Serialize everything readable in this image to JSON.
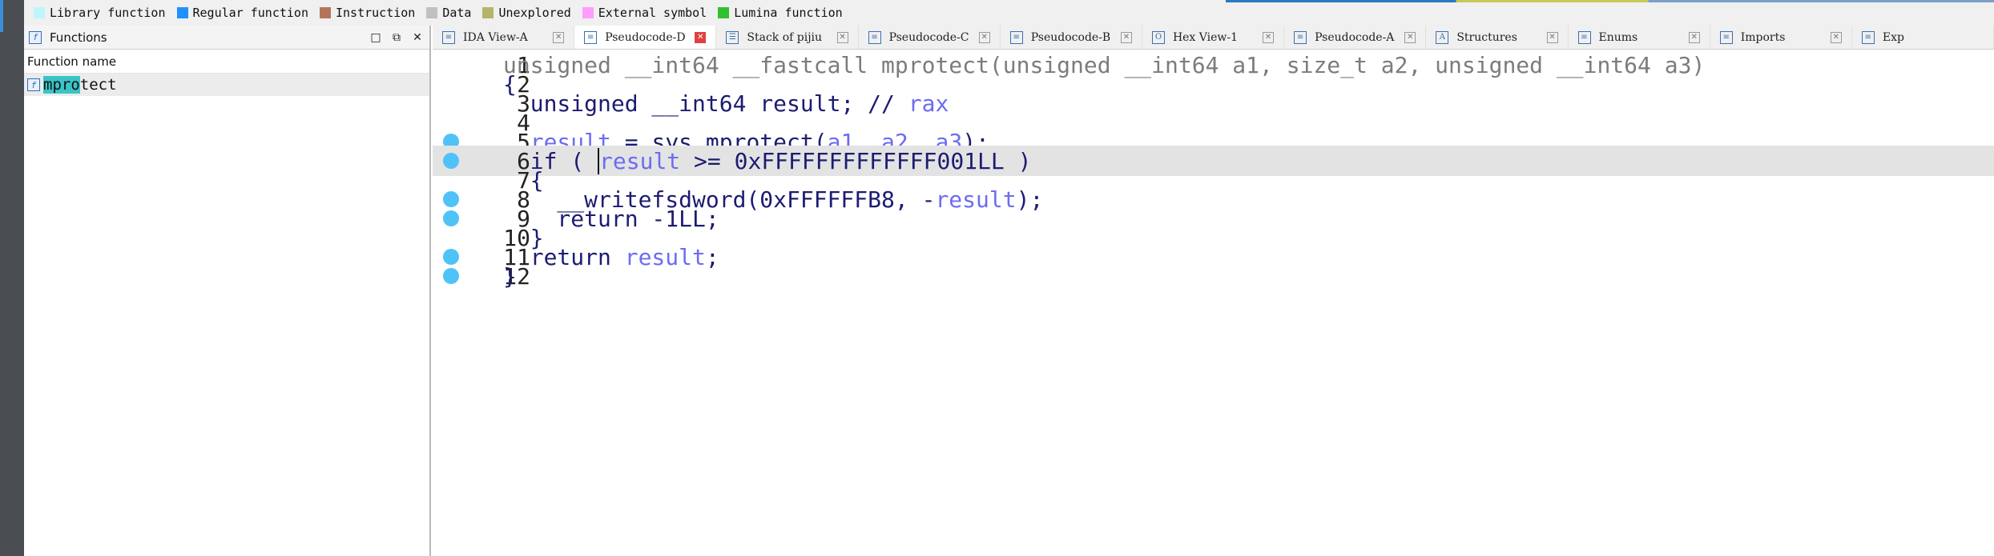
{
  "legend": [
    {
      "label": "Library function",
      "color": "#bff5ff"
    },
    {
      "label": "Regular function",
      "color": "#1e90ff"
    },
    {
      "label": "Instruction",
      "color": "#b5745a"
    },
    {
      "label": "Data",
      "color": "#c0c0c0"
    },
    {
      "label": "Unexplored",
      "color": "#b4b46a"
    },
    {
      "label": "External symbol",
      "color": "#ff9cff"
    },
    {
      "label": "Lumina function",
      "color": "#30c030"
    }
  ],
  "functions_panel": {
    "title": "Functions",
    "column_header": "Function name",
    "rows": [
      {
        "highlight": "mpro",
        "rest": "tect"
      }
    ]
  },
  "tabs": [
    {
      "label": "IDA View-A",
      "icon": "disassembly-icon",
      "active": false
    },
    {
      "label": "Pseudocode-D",
      "icon": "pseudocode-icon",
      "active": true
    },
    {
      "label": "Stack of pijiu",
      "icon": "stack-icon",
      "active": false
    },
    {
      "label": "Pseudocode-C",
      "icon": "pseudocode-icon",
      "active": false
    },
    {
      "label": "Pseudocode-B",
      "icon": "pseudocode-icon",
      "active": false
    },
    {
      "label": "Hex View-1",
      "icon": "hex-icon",
      "active": false
    },
    {
      "label": "Pseudocode-A",
      "icon": "pseudocode-icon",
      "active": false
    },
    {
      "label": "Structures",
      "icon": "structures-icon",
      "active": false
    },
    {
      "label": "Enums",
      "icon": "enums-icon",
      "active": false
    },
    {
      "label": "Imports",
      "icon": "imports-icon",
      "active": false
    },
    {
      "label": "Exp",
      "icon": "exports-icon",
      "active": false
    }
  ],
  "code": {
    "line_numbers": [
      "1",
      "2",
      "3",
      "4",
      "5",
      "6",
      "7",
      "8",
      "9",
      "10",
      "11",
      "12"
    ],
    "l1": {
      "sig_head": "unsigned __int64 __fastcall mprotect(unsigned __int64 a1, size_t a2, unsigned __int64 a3)"
    },
    "l2": {
      "text": "{"
    },
    "l3": {
      "decl": "  unsigned __int64 result; // ",
      "reg": "rax"
    },
    "l5": {
      "indent": "  ",
      "result": "result",
      "mid": " = sys_mprotect(",
      "a1": "a1",
      "c1": ", ",
      "a2": "a2",
      "c2": ", ",
      "a3": "a3",
      "end": ");"
    },
    "l6": {
      "pre": "  if ( ",
      "result": "result",
      "post": " >= 0xFFFFFFFFFFFFF001LL )"
    },
    "l7": {
      "text": "  {"
    },
    "l8": {
      "pre": "    __writefsdword(0xFFFFFFB8, -",
      "result": "result",
      "post": ");"
    },
    "l9": {
      "text": "    return -1LL;"
    },
    "l10": {
      "text": "  }"
    },
    "l11": {
      "pre": "  return ",
      "result": "result",
      "post": ";"
    },
    "l12": {
      "text": "}"
    }
  }
}
